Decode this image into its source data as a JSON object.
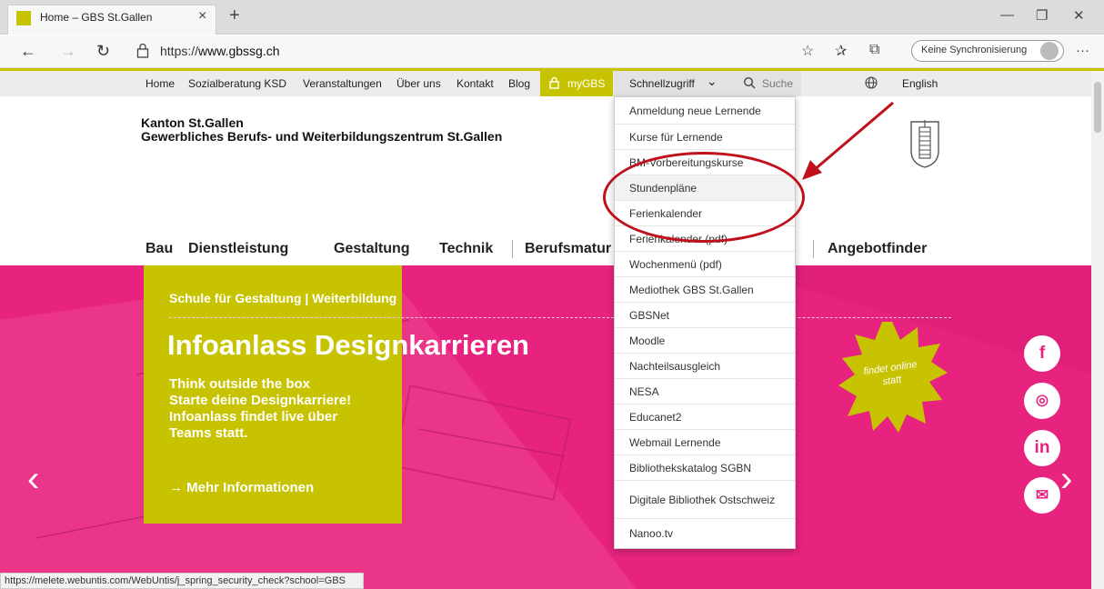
{
  "browser": {
    "tab_title": "Home – GBS St.Gallen",
    "url_prefix": "https://",
    "url_domain": "www.gbssg.ch",
    "sync_label": "Keine Synchronisierung"
  },
  "topnav": {
    "items": [
      "Home",
      "Sozialberatung KSD",
      "Veranstaltungen",
      "Über uns",
      "Kontakt",
      "Blog"
    ],
    "mygbs": "myGBS",
    "schnellzugriff": "Schnellzugriff",
    "search_placeholder": "Suche",
    "language": "English"
  },
  "header": {
    "line1": "Kanton St.Gallen",
    "line2": "Gewerbliches Berufs- und Weiterbildungszentrum St.Gallen"
  },
  "mainnav": {
    "items": [
      "Bau",
      "Dienstleistung",
      "Gestaltung",
      "Technik",
      "Berufsmatur",
      "Angebotfinder"
    ]
  },
  "hero": {
    "subtitle": "Schule für Gestaltung | Weiterbildung",
    "title": "Infoanlass Designkarrieren",
    "body1": "Think outside the box",
    "body2": "Starte deine Designkarriere!",
    "body3": "Infoanlass findet live über",
    "body4": "Teams statt.",
    "more": "Mehr Informationen",
    "badge1": "findet online",
    "badge2": "statt"
  },
  "dropdown": {
    "items": [
      "Anmeldung neue Lernende",
      "Kurse für Lernende",
      "BM-Vorbereitungskurse",
      "Stundenpläne",
      "Ferienkalender",
      "Ferienkalender (pdf)",
      "Wochenmenü (pdf)",
      "Mediothek GBS St.Gallen",
      "GBSNet",
      "Moodle",
      "Nachteilsausgleich",
      "NESA",
      "Educanet2",
      "Webmail Lernende",
      "Bibliothekskatalog SGBN",
      "Digitale Bibliothek Ostschweiz",
      "Nanoo.tv"
    ],
    "highlighted_item": "Stundenpläne"
  },
  "statusbar": {
    "text": "https://melete.webuntis.com/WebUntis/j_spring_security_check?school=GBS"
  },
  "colors": {
    "accent": "#c8c300",
    "hero": "#e8237f",
    "annotation": "#c0101b"
  },
  "icons": [
    "back-icon",
    "forward-icon",
    "refresh-icon",
    "lock-icon",
    "star-icon",
    "favorites-icon",
    "collections-icon",
    "more-icon",
    "chevron-down-icon",
    "search-icon",
    "globe-icon",
    "facebook-icon",
    "instagram-icon",
    "linkedin-icon",
    "mail-icon"
  ]
}
